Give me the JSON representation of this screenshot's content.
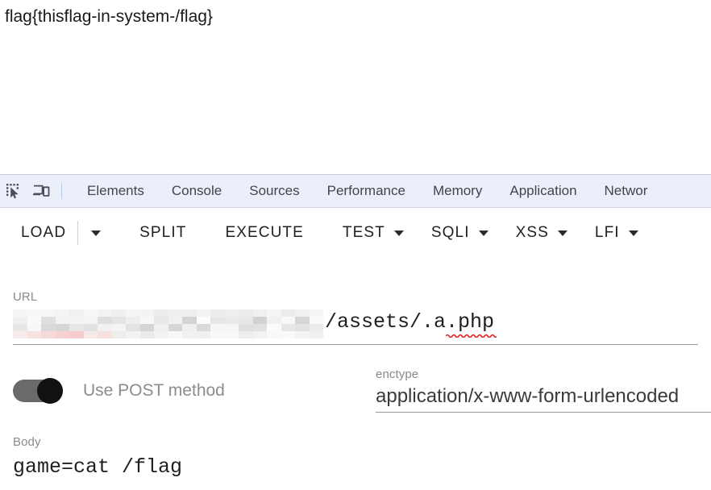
{
  "page": {
    "flag_text": "flag{thisflag-in-system-/flag}"
  },
  "devtools": {
    "icons": {
      "inspect": "inspect-element-icon",
      "device": "device-toolbar-icon"
    },
    "tabs": [
      {
        "label": "Elements"
      },
      {
        "label": "Console"
      },
      {
        "label": "Sources"
      },
      {
        "label": "Performance"
      },
      {
        "label": "Memory"
      },
      {
        "label": "Application"
      },
      {
        "label": "Networ"
      }
    ]
  },
  "toolbar": {
    "load_label": "LOAD",
    "split_label": "SPLIT",
    "execute_label": "EXECUTE",
    "test_label": "TEST",
    "sqli_label": "SQLI",
    "xss_label": "XSS",
    "lfi_label": "LFI"
  },
  "form": {
    "url": {
      "label": "URL",
      "redacted": true,
      "visible_value": "/assets/.a.php",
      "spellcheck_underline": true
    },
    "post_toggle": {
      "label": "Use POST method",
      "state": "on"
    },
    "enctype": {
      "label": "enctype",
      "value": "application/x-www-form-urlencoded"
    },
    "body": {
      "label": "Body",
      "value": "game=cat /flag"
    }
  },
  "colors": {
    "tabbar_bg": "#eaeffa",
    "toggle_track": "#6a6a6a",
    "toggle_knob": "#111111",
    "spellcheck": "#ee2222",
    "label_gray": "#8a8a8a"
  }
}
